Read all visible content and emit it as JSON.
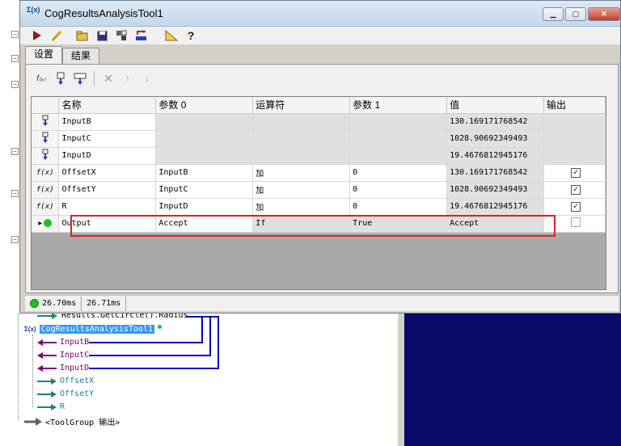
{
  "window": {
    "title": "CogResultsAnalysisTool1",
    "title_icon_text": "Σ(x)"
  },
  "toolbar": {
    "icons": [
      "run-icon",
      "edit-icon",
      "open-icon",
      "save-icon",
      "properties-icon",
      "reset-icon",
      "angle-icon",
      "help-icon"
    ]
  },
  "tabs": [
    {
      "label": "设置",
      "active": true
    },
    {
      "label": "结果",
      "active": false
    }
  ],
  "grid": {
    "headers": [
      "名称",
      "参数 0",
      "运算符",
      "参数 1",
      "值",
      "输出"
    ],
    "rows": [
      {
        "icon": "input-icon",
        "name": "InputB",
        "p0": "",
        "op": "",
        "p1": "",
        "value": "130.169171768542",
        "output": null,
        "kind": "input"
      },
      {
        "icon": "input-icon",
        "name": "InputC",
        "p0": "",
        "op": "",
        "p1": "",
        "value": "1028.90692349493",
        "output": null,
        "kind": "input"
      },
      {
        "icon": "input-icon",
        "name": "InputD",
        "p0": "",
        "op": "",
        "p1": "",
        "value": "19.4676812945176",
        "output": null,
        "kind": "input"
      },
      {
        "icon": "function-icon",
        "name": "OffsetX",
        "p0": "InputB",
        "op": "加",
        "p1": "0",
        "value": "130.169171768542",
        "output": true,
        "kind": "expr"
      },
      {
        "icon": "function-icon",
        "name": "OffsetY",
        "p0": "InputC",
        "op": "加",
        "p1": "0",
        "value": "1028.90692349493",
        "output": true,
        "kind": "expr"
      },
      {
        "icon": "function-icon",
        "name": "R",
        "p0": "InputD",
        "op": "加",
        "p1": "0",
        "value": "19.4676812945176",
        "output": true,
        "kind": "expr"
      },
      {
        "icon": "status-dot-icon",
        "name": "Output",
        "p0": "Accept",
        "op": "If",
        "p1": "True",
        "value": "Accept",
        "output": false,
        "kind": "current"
      }
    ]
  },
  "status": {
    "time1": "26.70ms",
    "time2": "26.71ms"
  },
  "tree": {
    "items": [
      {
        "label": "Results.GetCircle().Radius",
        "kind": "output"
      },
      {
        "label": "CogResultsAnalysisTool1",
        "kind": "tool",
        "selected": true
      },
      {
        "label": "InputB",
        "kind": "input"
      },
      {
        "label": "InputC",
        "kind": "input"
      },
      {
        "label": "InputD",
        "kind": "input"
      },
      {
        "label": "OffsetX",
        "kind": "output"
      },
      {
        "label": "OffsetY",
        "kind": "output"
      },
      {
        "label": "R",
        "kind": "output"
      },
      {
        "label": "<ToolGroup 输出>",
        "kind": "group"
      }
    ]
  },
  "colors": {
    "highlight": "#e02020",
    "input_arrow": "#800080",
    "output_arrow": "#208080",
    "link_line": "#0000c0",
    "selected_bg": "#3399ff",
    "image_bg": "#0a0a6a"
  }
}
